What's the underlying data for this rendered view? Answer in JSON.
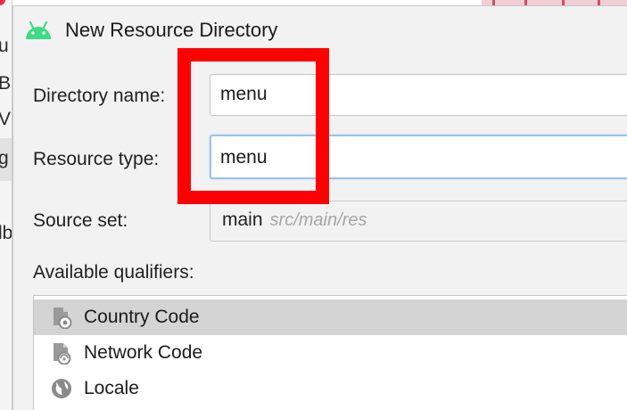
{
  "background": {
    "left_fragments": [
      "u",
      "B",
      "Vi",
      "g",
      "lb"
    ]
  },
  "dialog": {
    "title": "New Resource Directory",
    "directory_name": {
      "label": "Directory name:",
      "value": "menu"
    },
    "resource_type": {
      "label": "Resource type:",
      "value": "menu"
    },
    "source_set": {
      "label": "Source set:",
      "value": "main",
      "path_hint": "src/main/res"
    },
    "qualifiers": {
      "label": "Available qualifiers:",
      "items": [
        {
          "label": "Country Code",
          "icon": "country-code-icon",
          "selected": true
        },
        {
          "label": "Network Code",
          "icon": "network-code-icon",
          "selected": false
        },
        {
          "label": "Locale",
          "icon": "globe-icon",
          "selected": false
        }
      ]
    }
  },
  "colors": {
    "annotation": "#ff0000",
    "android_green": "#3ddc84",
    "focus_border": "#9cc3ea",
    "selected_row": "#d4d4d4"
  }
}
